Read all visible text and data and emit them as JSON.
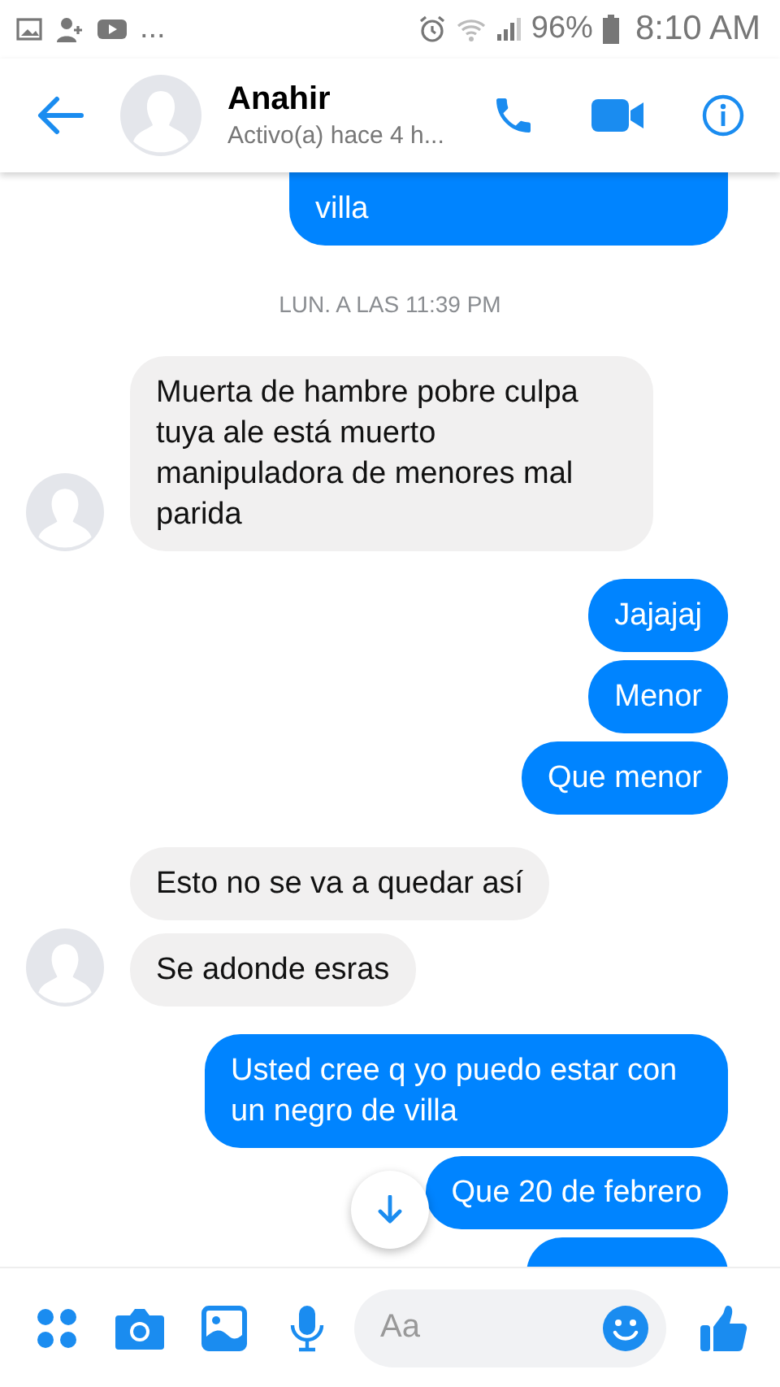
{
  "status_bar": {
    "more": "...",
    "battery": "96%",
    "time": "8:10 AM"
  },
  "header": {
    "name": "Anahir",
    "status": "Activo(a) hace 4 h..."
  },
  "messages": [
    {
      "kind": "sent",
      "text": "villa",
      "cut_off": true
    },
    {
      "kind": "time",
      "text": "LUN. A LAS 11:39 PM"
    },
    {
      "kind": "received",
      "text": "Muerta de hambre pobre culpa tuya ale está muerto manipuladora de menores mal parida"
    },
    {
      "kind": "sent",
      "text": "Jajajaj"
    },
    {
      "kind": "sent",
      "text": "Menor"
    },
    {
      "kind": "sent",
      "text": "Que menor"
    },
    {
      "kind": "received",
      "text": "Esto no se va a quedar así"
    },
    {
      "kind": "received",
      "text": "Se adonde esras"
    },
    {
      "kind": "sent",
      "text": "Usted cree q yo puedo estar con un negro de villa"
    },
    {
      "kind": "sent",
      "text": "Que 20 de febrero"
    },
    {
      "kind": "sent",
      "cut_off": true
    }
  ],
  "composer": {
    "placeholder": "Aa"
  }
}
